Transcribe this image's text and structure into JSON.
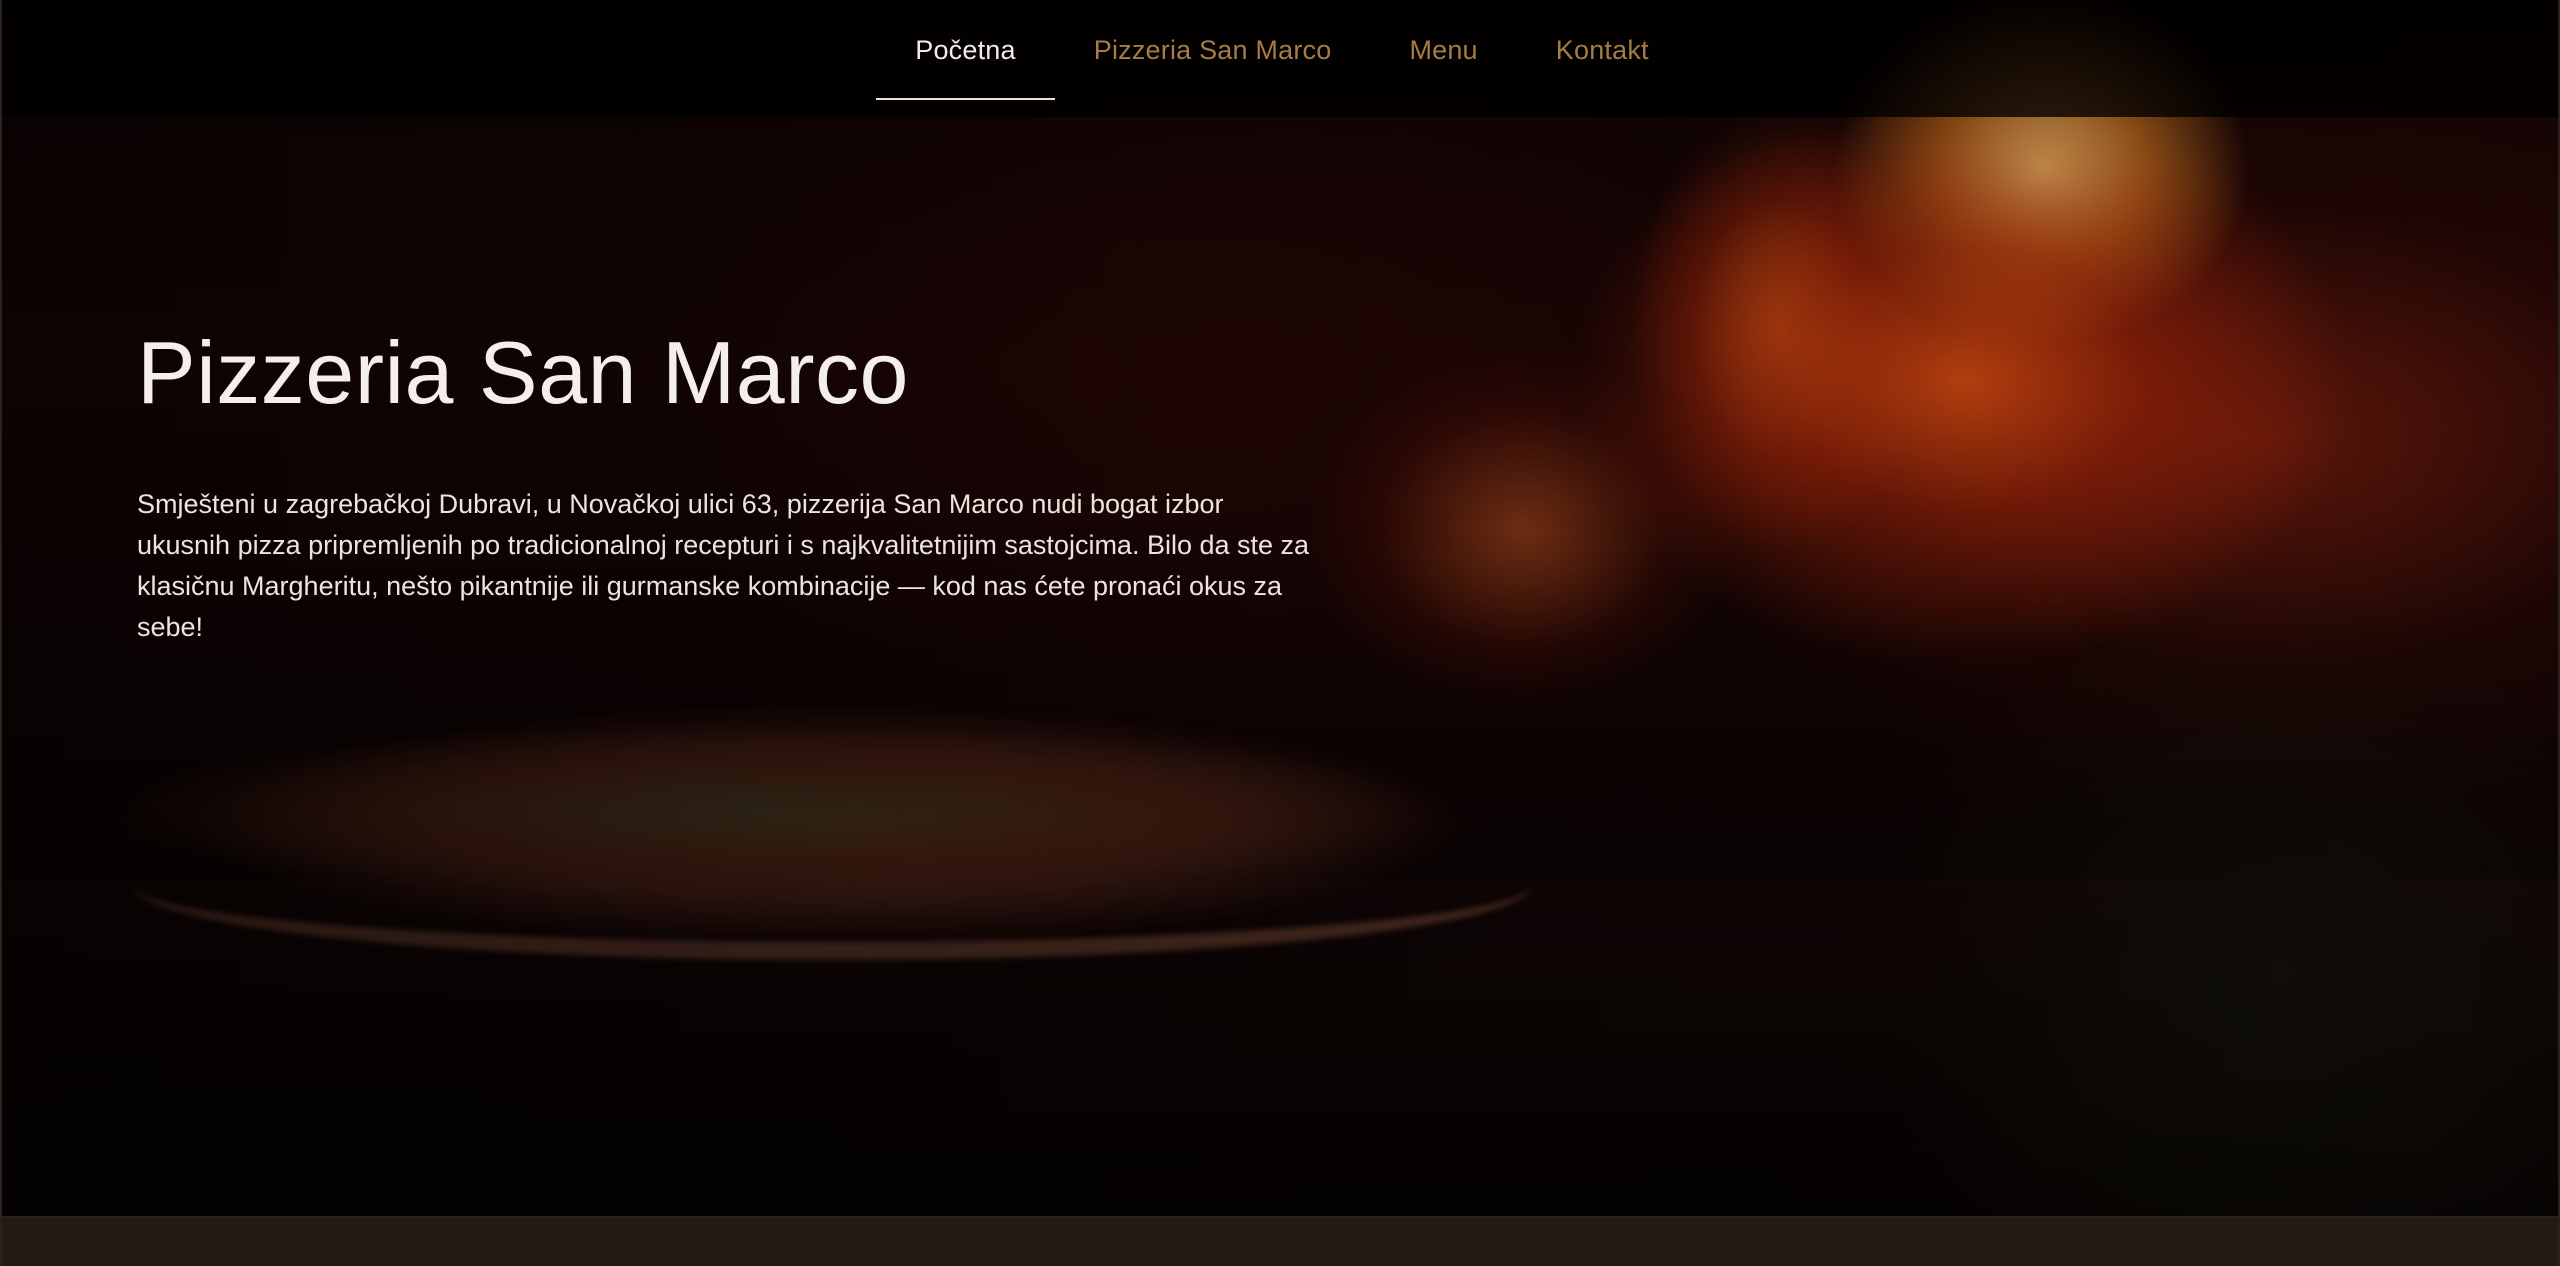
{
  "nav": {
    "items": [
      {
        "label": "Početna",
        "active": true
      },
      {
        "label": "Pizzeria San Marco",
        "active": false
      },
      {
        "label": "Menu",
        "active": false
      },
      {
        "label": "Kontakt",
        "active": false
      }
    ]
  },
  "hero": {
    "title": "Pizzeria San Marco",
    "description": "Smješteni u zagrebačkoj Dubravi, u Novačkoj ulici 63, pizzerija San Marco nudi bogat izbor ukusnih pizza pripremljenih po tradicionalnoj recepturi i s najkvalitetnijim sastojcima. Bilo da ste za klasičnu Margheritu, nešto pikantnije ili gurmanske kombinacije — kod nas ćete pronaći okus za sebe!",
    "background_image": "wood-fired-oven-with-pizza"
  },
  "colors": {
    "nav_background": "#000000",
    "nav_active": "#f2ece6",
    "nav_inactive": "#a57c45",
    "text": "#f4efe9",
    "footer_strip": "#241915"
  }
}
